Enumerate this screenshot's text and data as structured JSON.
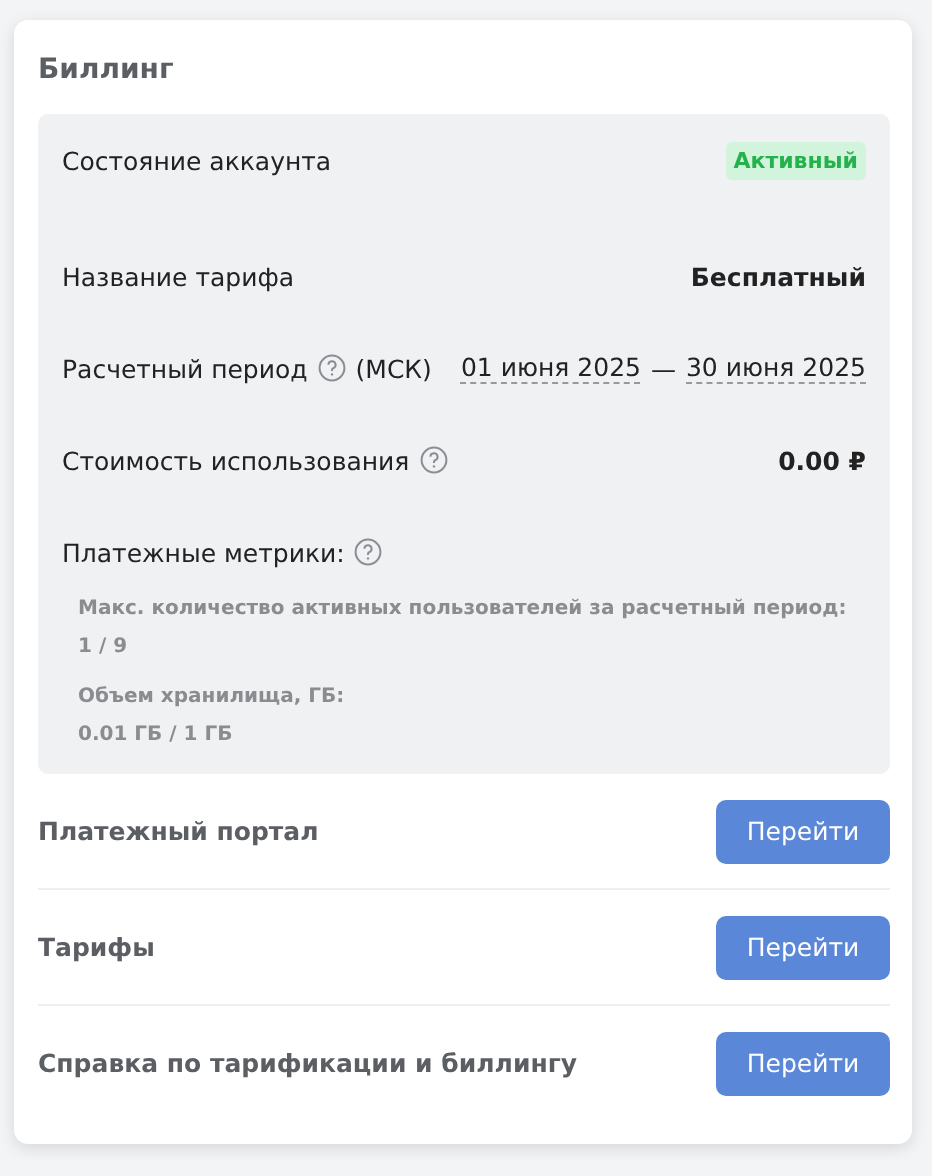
{
  "dialog": {
    "title": "Биллинг"
  },
  "account": {
    "status_label": "Состояние аккаунта",
    "status": {
      "text": "Активный",
      "kind": "active"
    },
    "plan_label": "Название тарифа",
    "plan": "Бесплатный",
    "period_label": "Расчетный период",
    "timezone": "(МСК)",
    "period_start": "01 июня 2025",
    "period_separator": "—",
    "period_end": "30 июня 2025",
    "cost_label": "Стоимость использования",
    "cost": "0.00 ₽",
    "metrics_label": "Платежные метрики:",
    "metrics": [
      {
        "label": "Макс. количество активных пользователей за расчетный период:",
        "value": "1 / 9"
      },
      {
        "label": "Объем хранилища, ГБ:",
        "value": "0.01 ГБ / 1 ГБ"
      }
    ]
  },
  "links": [
    {
      "label": "Платежный портал",
      "button": "Перейти"
    },
    {
      "label": "Тарифы",
      "button": "Перейти"
    },
    {
      "label": "Справка по тарификации и биллингу",
      "button": "Перейти"
    }
  ]
}
